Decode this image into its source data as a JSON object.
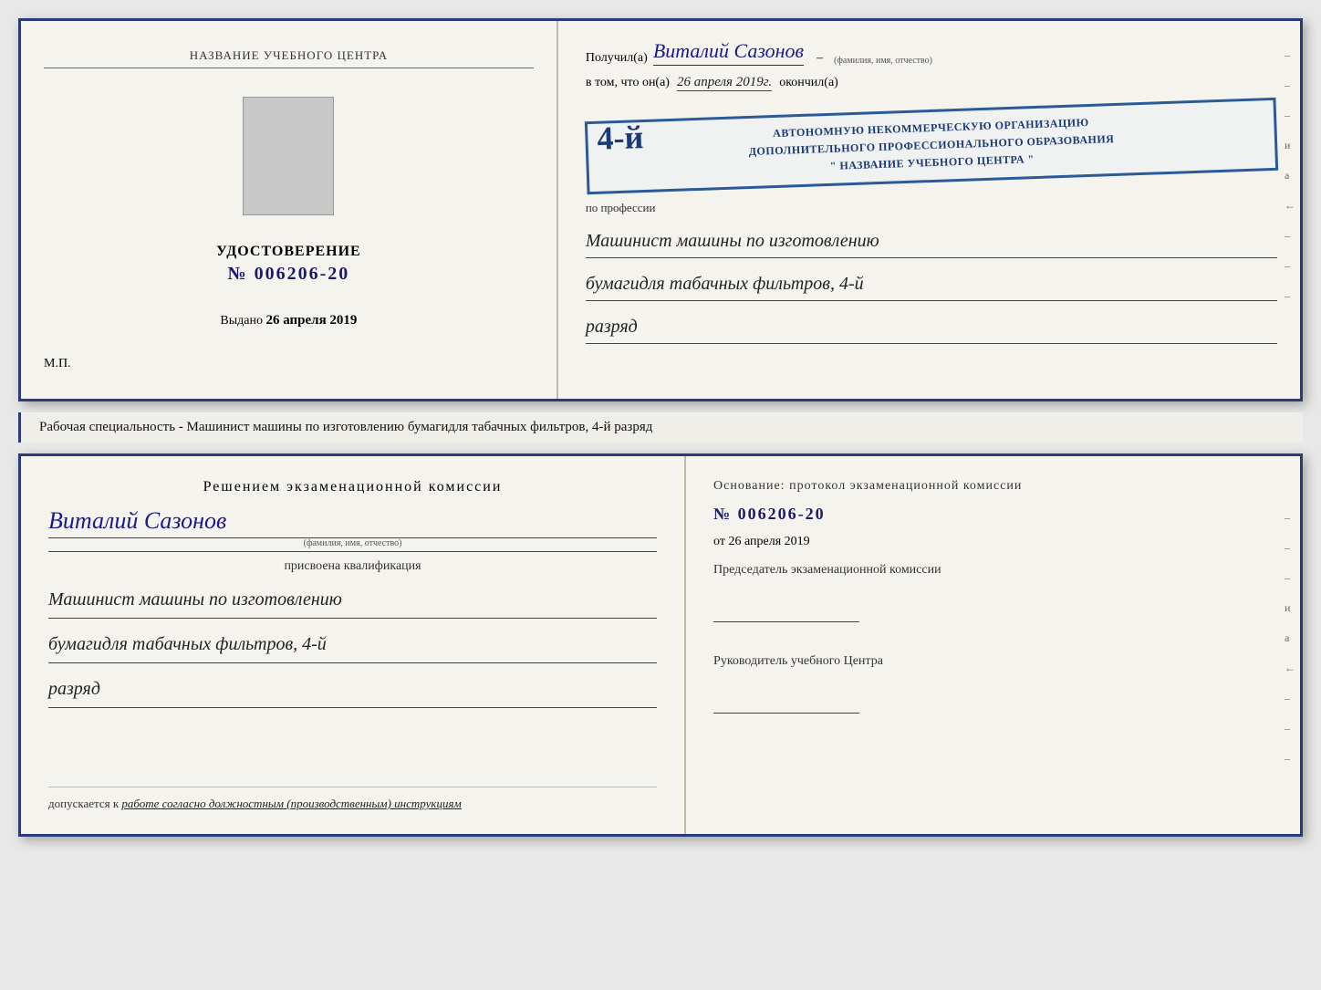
{
  "topDoc": {
    "leftPanel": {
      "orgNameLabel": "НАЗВАНИЕ УЧЕБНОГО ЦЕНТРА",
      "certTitle": "УДОСТОВЕРЕНИЕ",
      "certNumber": "№ 006206-20",
      "issuedLabel": "Выдано",
      "issuedDate": "26 апреля 2019",
      "mpLabel": "М.П."
    },
    "rightPanel": {
      "recipientPrefix": "Получил(а)",
      "recipientName": "Виталий Сазонов",
      "recipientNameSmall": "(фамилия, имя, отчество)",
      "vtomPrefix": "в том, что он(а)",
      "date": "26 апреля 2019г.",
      "okoncilLabel": "окончил(а)",
      "stampNumber": "4-й",
      "stampLine1": "АВТОНОМНУЮ НЕКОММЕРЧЕСКУЮ ОРГАНИЗАЦИЮ",
      "stampLine2": "ДОПОЛНИТЕЛЬНОГО ПРОФЕССИОНАЛЬНОГО ОБРАЗОВАНИЯ",
      "stampLine3": "\" НАЗВАНИЕ УЧЕБНОГО ЦЕНТРА \"",
      "professionLabel": "по профессии",
      "profession1": "Машинист машины по изготовлению",
      "profession2": "бумагидля табачных фильтров, 4-й",
      "profession3": "разряд",
      "rightMarks": [
        "–",
        "–",
        "–",
        "и",
        "а",
        "←",
        "–",
        "–",
        "–"
      ]
    }
  },
  "middleText": {
    "content": "Рабочая специальность - Машинист машины по изготовлению бумагидля табачных фильтров, 4-й разряд"
  },
  "bottomDoc": {
    "leftPanel": {
      "decisionTitle": "Решением  экзаменационной  комиссии",
      "personName": "Виталий Сазонов",
      "personNameSmall": "(фамилия, имя, отчество)",
      "assignedLabel": "присвоена квалификация",
      "qualification1": "Машинист машины по изготовлению",
      "qualification2": "бумагидля табачных фильтров, 4-й",
      "qualification3": "разряд",
      "allowedPrefix": "допускается к",
      "allowedValue": "работе согласно должностным (производственным) инструкциям"
    },
    "rightPanel": {
      "osnov": "Основание:  протокол  экзаменационной  комиссии",
      "docNum": "№  006206-20",
      "fromLabel": "от",
      "fromDate": "26 апреля 2019",
      "chairmanLabel": "Председатель экзаменационной комиссии",
      "headLabel": "Руководитель учебного Центра",
      "rightMarks": [
        "–",
        "–",
        "–",
        "и",
        "а",
        "←",
        "–",
        "–",
        "–"
      ]
    }
  }
}
